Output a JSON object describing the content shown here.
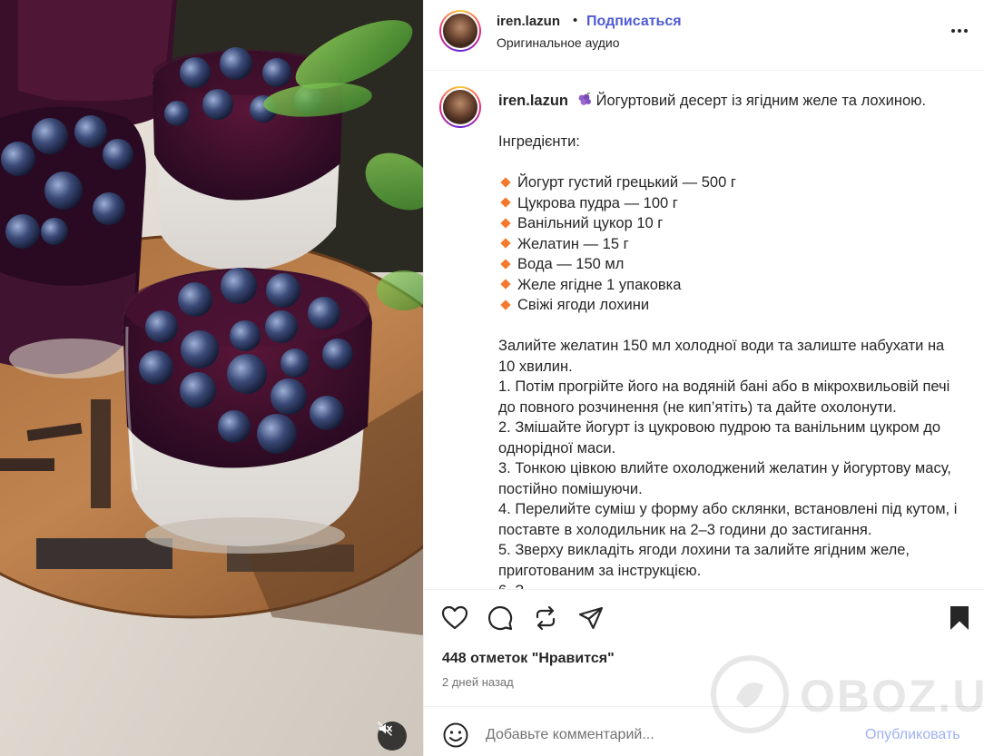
{
  "media": {
    "mute_icon": "speaker-muted-icon"
  },
  "header": {
    "username": "iren.lazun",
    "separator": "•",
    "follow_label": "Подписаться",
    "audio": "Оригинальное аудио",
    "more_icon": "more-horizontal-icon"
  },
  "caption": {
    "username": "iren.lazun",
    "emoji": "grapes-icon",
    "title": "Йогуртовий десерт із ягідним желе та лохиною.",
    "ingredients_heading": "Інгредієнти:",
    "ingredients": [
      "Йогурт густий грецький — 500 г",
      "Цукрова пудра — 100 г",
      "Ванільний цукор 10 г",
      "Желатин — 15 г",
      "Вода — 150 мл",
      "Желе ягідне 1 упаковка",
      "Свіжі ягоди лохини"
    ],
    "steps": [
      "Залийте желатин 150 мл холодної води та залиште набухати на 10 хвилин.",
      "1. Потім прогрійте його на водяній бані або в мікрохвильовій печі до повного розчинення (не кип’ятіть) та дайте охолонути.",
      "2. Змішайте йогурт із цукровою пудрою та ванільним цукром до однорідної маси.",
      "3. Тонкою цівкою влийте охолоджений желатин у йогуртову масу, постійно помішуючи.",
      "4. Перелийте суміш у форму або склянки, встановлені під кутом, і поставте в холодильник на 2–3 години до застигання.",
      "5. Зверху викладіть ягоди лохини та залийте ягідним желе, приготованим за інструкцією.",
      "6. З"
    ]
  },
  "actions": {
    "like_icon": "heart-icon",
    "comment_icon": "comment-icon",
    "repost_icon": "repost-icon",
    "share_icon": "share-icon",
    "save_icon": "bookmark-icon"
  },
  "likes": "448 отметок \"Нравится\"",
  "time": "2 дней назад",
  "comment": {
    "emoji_icon": "emoji-icon",
    "placeholder": "Добавьте комментарий...",
    "publish_label": "Опубликовать"
  },
  "watermark": {
    "text": "OBOZ.UA"
  },
  "colors": {
    "follow": "#4f5bd5",
    "publish": "#9fb1f2",
    "bullet": "#f4792c",
    "text": "#262626",
    "secondary": "#737373"
  }
}
